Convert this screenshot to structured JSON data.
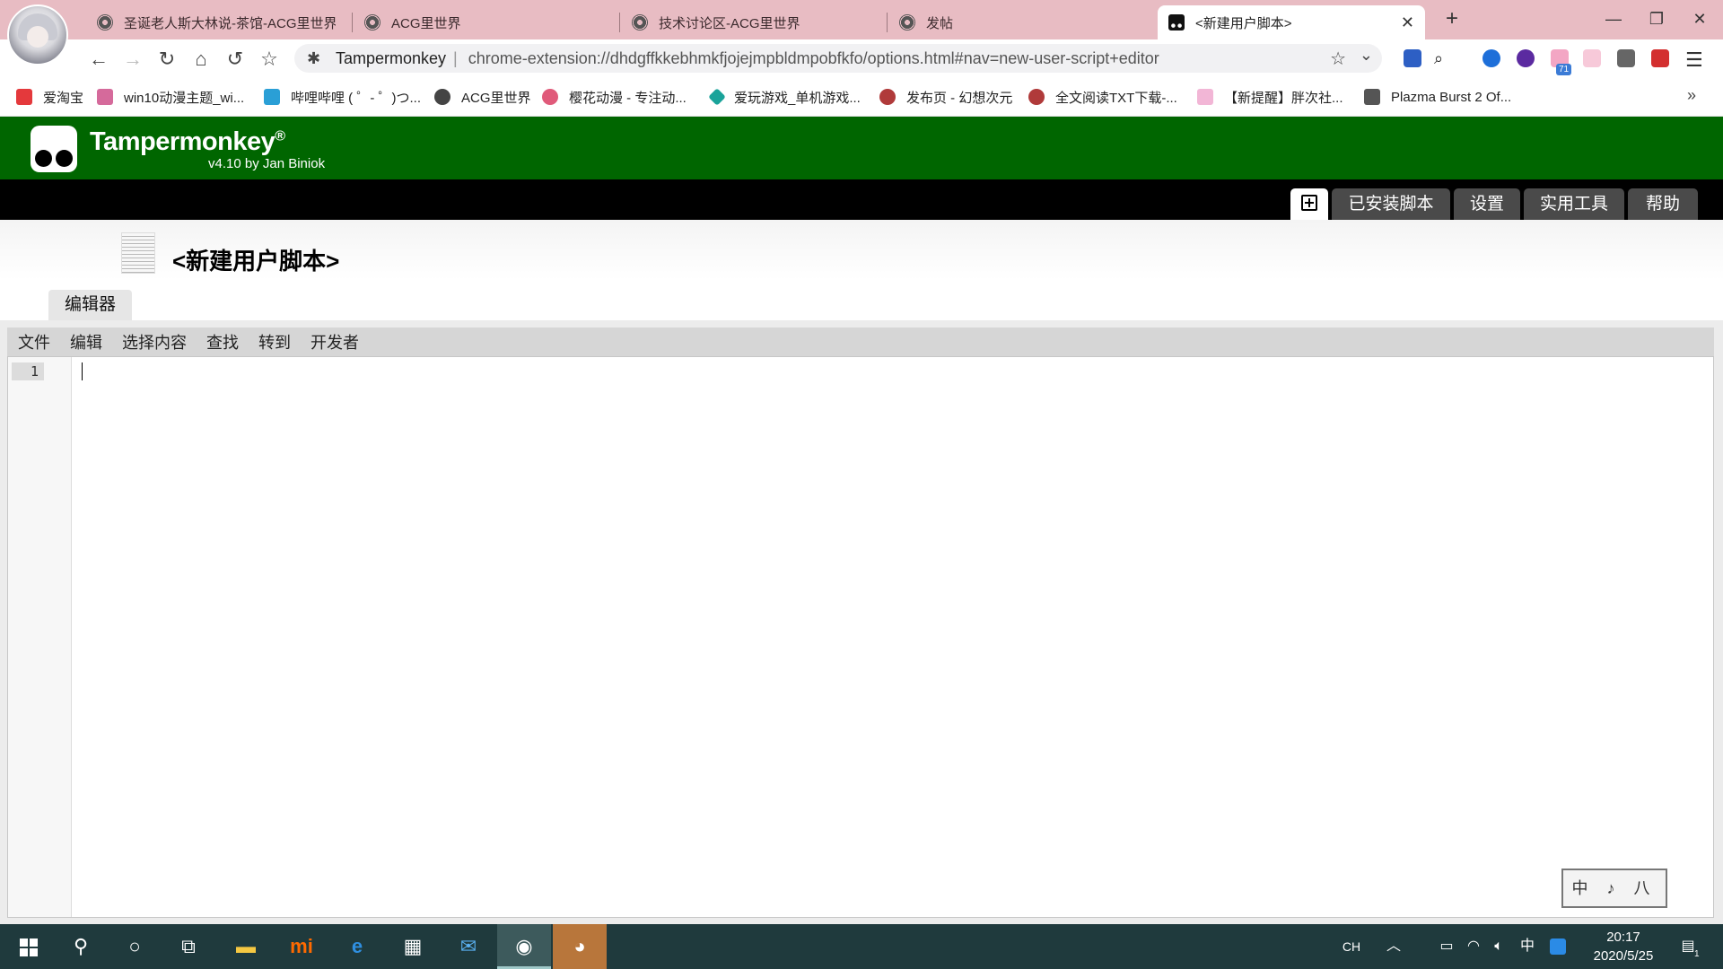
{
  "browser": {
    "tabs": [
      {
        "title": "圣诞老人斯大林说-茶馆-ACG里世界",
        "active": false
      },
      {
        "title": "ACG里世界",
        "active": false
      },
      {
        "title": "技术讨论区-ACG里世界",
        "active": false
      },
      {
        "title": "发帖",
        "active": false
      },
      {
        "title": "<新建用户脚本>",
        "active": true
      }
    ],
    "new_tab": "+",
    "close_tab": "✕",
    "window_controls": {
      "minimize": "—",
      "restore": "❐",
      "close": "✕"
    },
    "omnibox": {
      "site": "Tampermonkey",
      "separator": "|",
      "url": "chrome-extension://dhdgffkkebhmkfjojejmpbldmpobfkfo/options.html#nav=new-user-script+editor"
    },
    "extension_badge": "71",
    "bookmarks": [
      {
        "label": "爱淘宝",
        "color": "#e4393c"
      },
      {
        "label": "win10动漫主题_wi...",
        "color": "#d56a9b"
      },
      {
        "label": "哔哩哔哩 ( ゜- ゜)つ...",
        "color": "#2a9fd6"
      },
      {
        "label": "ACG里世界",
        "color": "#444444"
      },
      {
        "label": "樱花动漫 - 专注动...",
        "color": "#e05a7a"
      },
      {
        "label": "爱玩游戏_单机游戏...",
        "color": "#1aa39a"
      },
      {
        "label": "发布页 - 幻想次元",
        "color": "#b03a3a"
      },
      {
        "label": "全文阅读TXT下载-...",
        "color": "#b03a3a"
      },
      {
        "label": "【新提醒】胖次社...",
        "color": "#f2b6d6"
      },
      {
        "label": "Plazma Burst 2 Of...",
        "color": "#555555"
      }
    ],
    "bookmarks_more": "»"
  },
  "tampermonkey": {
    "title": "Tampermonkey",
    "registered": "®",
    "version": "v4.10 by Jan Biniok",
    "nav": [
      {
        "label": "",
        "icon": "plus-square-icon",
        "active": true
      },
      {
        "label": "已安装脚本",
        "active": false
      },
      {
        "label": "设置",
        "active": false
      },
      {
        "label": "实用工具",
        "active": false
      },
      {
        "label": "帮助",
        "active": false
      }
    ],
    "script_title": "<新建用户脚本>",
    "editor_tab": "编辑器",
    "menu": [
      "文件",
      "编辑",
      "选择内容",
      "查找",
      "转到",
      "开发者"
    ],
    "line_number": "1",
    "ime_widget": "中 ♪ 八"
  },
  "taskbar": {
    "tray_lang": "CH",
    "ime": "中",
    "time": "20:17",
    "date": "2020/5/25",
    "notifications": "1"
  },
  "colors": {
    "tab_strip": "#e8bcc3",
    "tm_green": "#006600",
    "tm_nav": "#000000",
    "taskbar": "#1f3a3d"
  }
}
